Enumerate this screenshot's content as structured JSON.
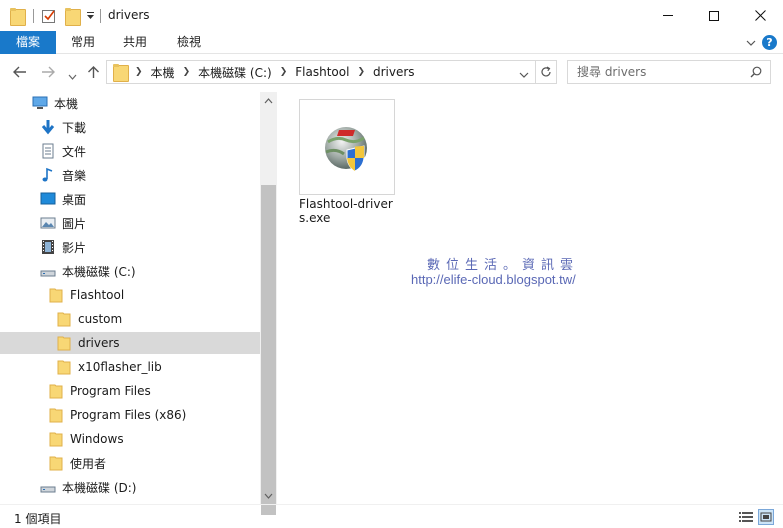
{
  "window": {
    "title": "drivers"
  },
  "ribbon": {
    "tabs": [
      "檔案",
      "常用",
      "共用",
      "檢視"
    ],
    "help": "?"
  },
  "address": {
    "crumbs": [
      "本機",
      "本機磁碟 (C:)",
      "Flashtool",
      "drivers"
    ],
    "search_placeholder": "搜尋 drivers"
  },
  "nav": {
    "items": [
      {
        "label": "本機",
        "icon": "computer-icon"
      },
      {
        "label": "下載",
        "icon": "download-icon"
      },
      {
        "label": "文件",
        "icon": "document-icon"
      },
      {
        "label": "音樂",
        "icon": "music-icon"
      },
      {
        "label": "桌面",
        "icon": "desktop-icon"
      },
      {
        "label": "圖片",
        "icon": "pictures-icon"
      },
      {
        "label": "影片",
        "icon": "videos-icon"
      },
      {
        "label": "本機磁碟 (C:)",
        "icon": "drive-icon"
      },
      {
        "label": "Flashtool",
        "icon": "folder-icon"
      },
      {
        "label": "custom",
        "icon": "folder-icon"
      },
      {
        "label": "drivers",
        "icon": "folder-icon",
        "selected": true
      },
      {
        "label": "x10flasher_lib",
        "icon": "folder-icon"
      },
      {
        "label": "Program Files",
        "icon": "folder-icon"
      },
      {
        "label": "Program Files (x86)",
        "icon": "folder-icon"
      },
      {
        "label": "Windows",
        "icon": "folder-icon"
      },
      {
        "label": "使用者",
        "icon": "folder-icon"
      },
      {
        "label": "本機磁碟 (D:)",
        "icon": "drive-icon"
      }
    ]
  },
  "content": {
    "files": [
      {
        "name": "Flashtool-drivers.exe",
        "icon": "nsis-installer-icon"
      }
    ],
    "watermark_title": "數位生活。資訊雲",
    "watermark_url": "http://elife-cloud.blogspot.tw/"
  },
  "status": {
    "item_count": "1 個項目"
  },
  "colors": {
    "accent": "#1979ca",
    "selection": "#d9d9d9",
    "watermark": "#5a68b5"
  }
}
